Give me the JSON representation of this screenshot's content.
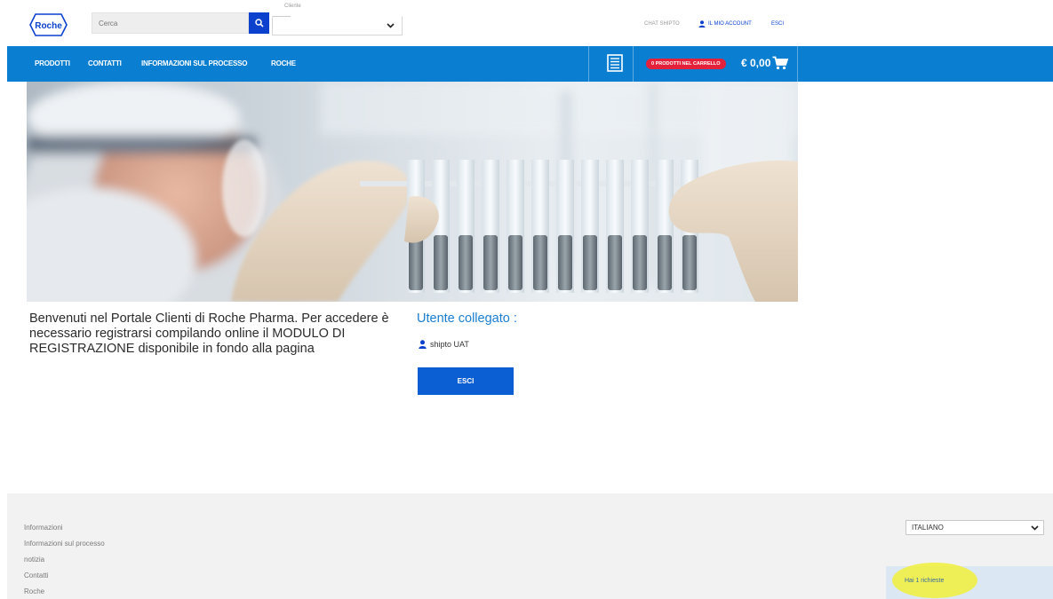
{
  "header": {
    "logo_text": "Roche",
    "search_placeholder": "Cerca",
    "cliente_label": "Cliente",
    "links": {
      "chat_shipto": "Chat shipto",
      "account": "Il mio account",
      "esci": "Esci"
    }
  },
  "nav": {
    "items": [
      "PRODOTTI",
      "CONTATTI",
      "INFORMAZIONI SUL PROCESSO",
      "ROCHE"
    ],
    "cart_badge": "0 PRODOTTI NEL CARRELLO",
    "cart_total": "€ 0,00"
  },
  "main": {
    "welcome_text": "Benvenuti nel Portale Clienti di Roche Pharma. Per accedere è necessario registrarsi compilando online il MODULO DI REGISTRAZIONE disponibile in fondo alla pagina",
    "user_heading": "Utente collegato :",
    "user_name": "shipto UAT",
    "logout_button": "ESCI"
  },
  "footer": {
    "links": [
      "Informazioni",
      "Informazioni sul processo",
      "notizia",
      "Contatti",
      "Roche"
    ],
    "language": "ITALIANO",
    "notification": "Hai 1 richieste"
  },
  "colors": {
    "nav_blue": "#0a7fd1",
    "roche_blue": "#0b41cd",
    "cart_red": "#e4213b",
    "heading_blue": "#1b7ed1",
    "footer_bg": "#f2f2f2",
    "highlight_yellow": "#f1f03a"
  },
  "icons": [
    "roche-logo",
    "search-icon",
    "chevron-down-icon",
    "user-icon",
    "list-icon",
    "cart-icon"
  ]
}
